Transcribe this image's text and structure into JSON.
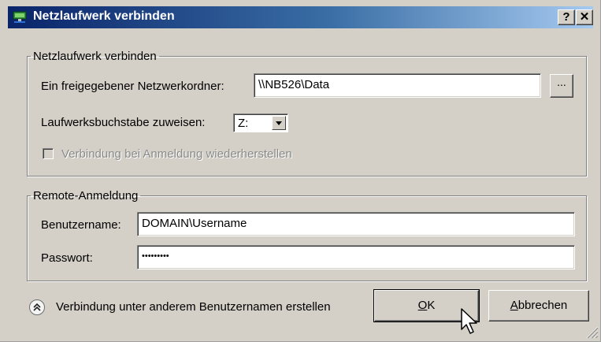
{
  "window": {
    "title": "Netzlaufwerk verbinden",
    "help_label": "?",
    "close_label": "✕"
  },
  "group_connect": {
    "legend": "Netzlaufwerk verbinden",
    "folder_label": "Ein freigegebener Netzwerkordner:",
    "folder_value": "\\\\NB526\\Data",
    "browse_label": "...",
    "drive_label": "Laufwerksbuchstabe zuweisen:",
    "drive_value": "Z:",
    "reconnect_label": "Verbindung bei Anmeldung wiederherstellen",
    "reconnect_checked": false
  },
  "group_remote": {
    "legend": "Remote-Anmeldung",
    "user_label": "Benutzername:",
    "user_value": "DOMAIN\\Username",
    "password_label": "Passwort:",
    "password_value": "•••••••••"
  },
  "footer": {
    "other_user_label": "Verbindung unter anderem Benutzernamen erstellen",
    "ok_mnemonic": "O",
    "ok_rest": "K",
    "cancel_mnemonic": "A",
    "cancel_rest": "bbrechen"
  },
  "colors": {
    "titlebar_start": "#0a246a",
    "titlebar_end": "#a6caf0",
    "dialog_face": "#d4d0c8"
  }
}
